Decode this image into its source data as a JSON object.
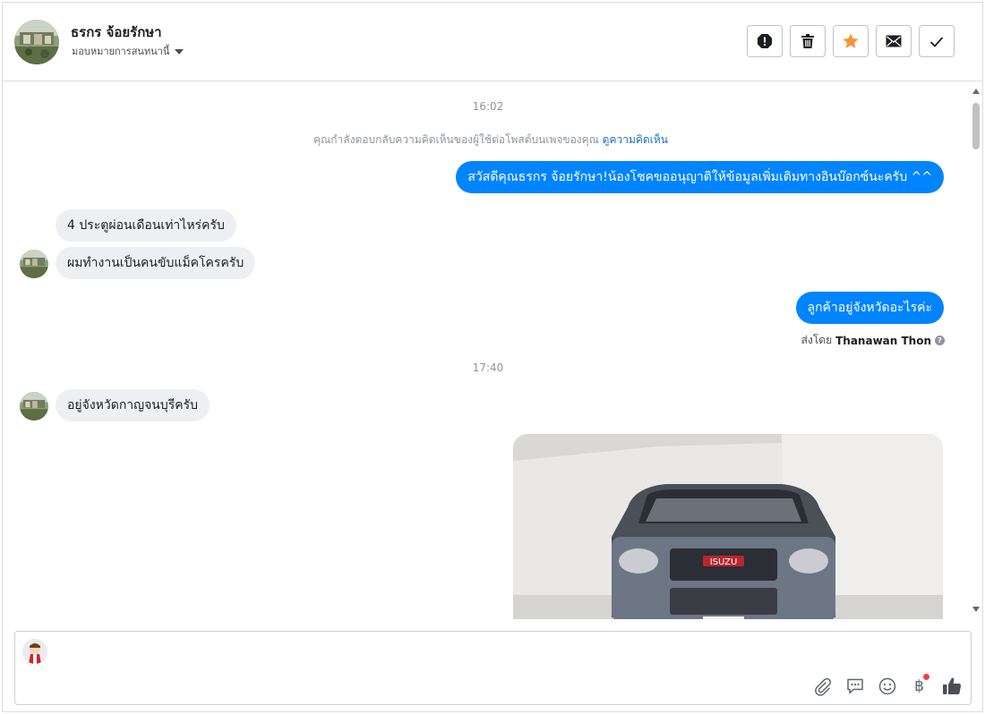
{
  "header": {
    "name": "ธรกร จ้อยรักษา",
    "assign_label": "มอบหมายการสนทนานี้",
    "actions": [
      {
        "name": "spam-icon"
      },
      {
        "name": "trash-icon"
      },
      {
        "name": "star-icon"
      },
      {
        "name": "mail-icon"
      },
      {
        "name": "check-icon"
      }
    ]
  },
  "chat": {
    "timestamp_1": "16:02",
    "notice_text": "คุณกำลังตอบกลับความคิดเห็นของผู้ใช้ต่อโพสต์บนเพจของคุณ",
    "notice_link": "ดูความคิดเห็น",
    "messages": [
      {
        "dir": "out",
        "text": "สวัสดีคุณธรกร จ้อยรักษา!น้องโชคขออนุญาติให้ข้อมูลเพิ่มเติมทางอินบ๊อกซ์นะครับ ^^"
      },
      {
        "dir": "in",
        "text": "4 ประตูผ่อนเดือนเท่าไหร่ครับ"
      },
      {
        "dir": "in",
        "text": "ผมทำงานเป็นคนขับแม็คโครครับ"
      },
      {
        "dir": "out",
        "text": "ลูกค้าอยู่จังหวัดอะไรค่ะ"
      },
      {
        "dir": "in",
        "text": "อยู่จังหวัดกาญจนบุรีครับ"
      }
    ],
    "sent_by_prefix": "ส่งโดย",
    "sent_by_name": "Thanawan Thon",
    "timestamp_2": "17:40",
    "photo_plate": "ISUZU"
  },
  "colors": {
    "outgoing": "#0084ff",
    "incoming": "#eeeff2",
    "star": "#f7923b",
    "link": "#1870c9"
  }
}
